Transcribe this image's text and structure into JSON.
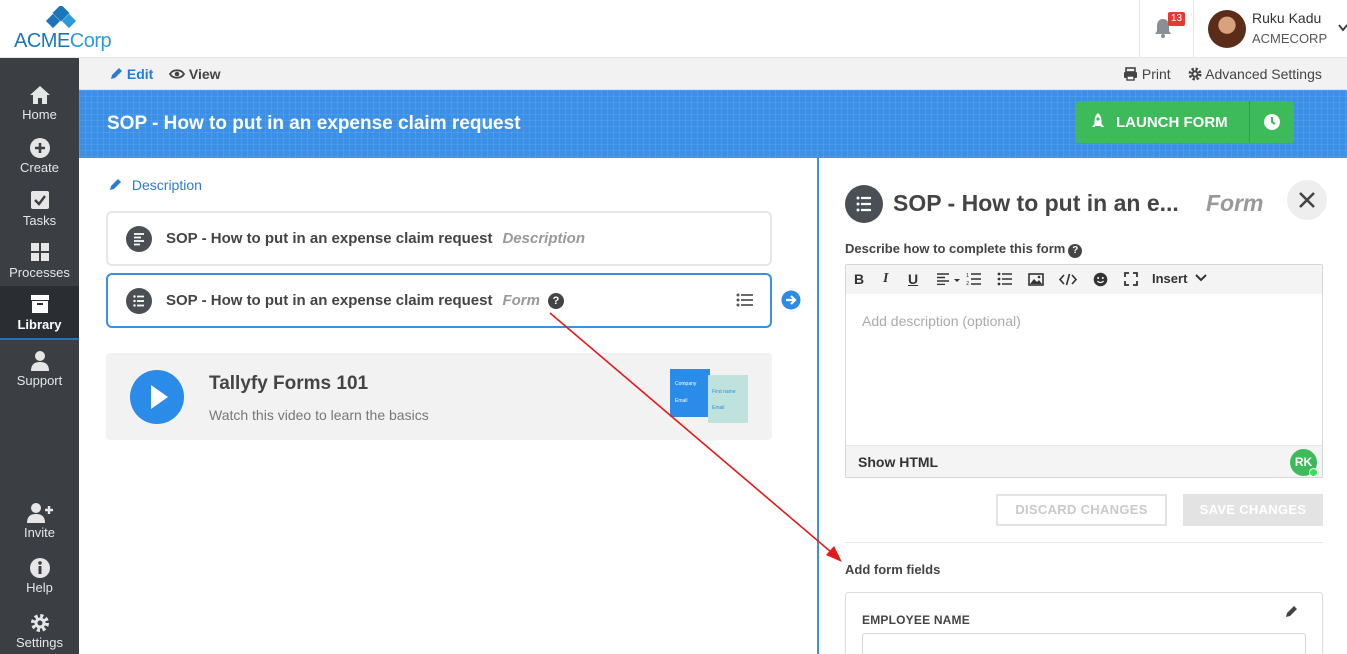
{
  "brand": {
    "name_part1": "ACME",
    "name_part2": "Corp"
  },
  "notifications": {
    "count": "13"
  },
  "user": {
    "name": "Ruku Kadu",
    "org": "ACMECORP"
  },
  "sidebar": {
    "items": [
      {
        "label": "Home",
        "icon": "home-icon"
      },
      {
        "label": "Create",
        "icon": "plus-circle-icon"
      },
      {
        "label": "Tasks",
        "icon": "checkbox-icon"
      },
      {
        "label": "Processes",
        "icon": "grid-icon"
      },
      {
        "label": "Library",
        "icon": "archive-icon",
        "active": true
      },
      {
        "label": "Support",
        "icon": "user-icon"
      }
    ],
    "bottom_items": [
      {
        "label": "Invite",
        "icon": "user-plus-icon"
      },
      {
        "label": "Help",
        "icon": "info-icon"
      },
      {
        "label": "Settings",
        "icon": "gear-icon"
      }
    ]
  },
  "subbar": {
    "edit": "Edit",
    "view": "View",
    "print": "Print",
    "advanced": "Advanced Settings"
  },
  "header": {
    "title": "SOP - How to put in an expense claim request",
    "launch_label": "LAUNCH FORM"
  },
  "left": {
    "description_link": "Description",
    "steps": [
      {
        "title": "SOP - How to put in an expense claim request",
        "type": "Description"
      },
      {
        "title": "SOP - How to put in an expense claim request",
        "type": "Form",
        "help": "?"
      }
    ],
    "video": {
      "title": "Tallyfy Forms 101",
      "subtitle": "Watch this video to learn the basics",
      "thumb_labels": [
        "Company",
        "Email",
        "First name",
        "Email"
      ]
    }
  },
  "panel": {
    "title": "SOP - How to put in an e...",
    "type": "Form",
    "describe_label": "Describe how to complete this form",
    "help": "?",
    "toolbar": {
      "bold": "B",
      "italic": "I",
      "underline": "U",
      "insert": "Insert"
    },
    "placeholder": "Add description (optional)",
    "show_html": "Show HTML",
    "avatar_initials": "RK",
    "discard": "DISCARD CHANGES",
    "save": "SAVE CHANGES",
    "add_fields": "Add form fields",
    "field": {
      "label": "EMPLOYEE NAME"
    }
  },
  "colors": {
    "accent": "#3b8fe5",
    "launch": "#3dba5a",
    "sidebar": "#3b3f44",
    "annotation": "#e21b1b"
  }
}
